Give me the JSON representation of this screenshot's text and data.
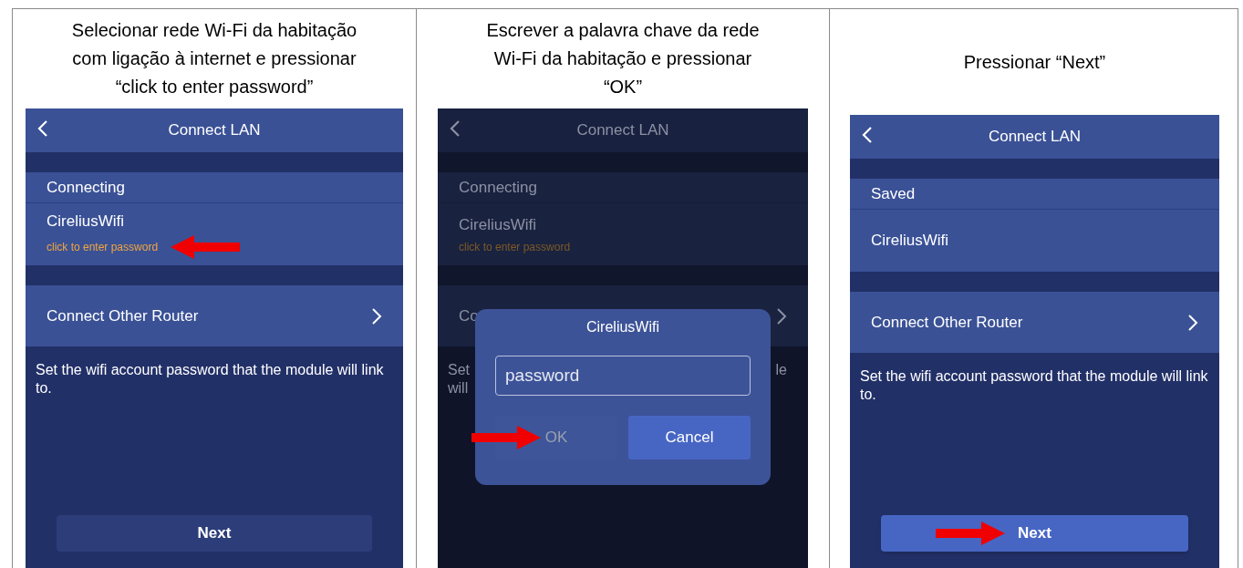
{
  "steps": [
    {
      "caption": "Selecionar rede Wi-Fi da habitação com ligação à internet e pressionar “click to enter password”",
      "screen": {
        "dimmed": false,
        "title": "Connect LAN",
        "section": "Connecting",
        "network": {
          "name": "CireliusWifi",
          "hint": "click to enter password",
          "pointed": true
        },
        "other_router": "Connect Other Router",
        "description": "Set the wifi account password that the module will link to.",
        "next_button": {
          "label": "Next",
          "highlighted": false,
          "pointed": false
        }
      }
    },
    {
      "caption": "Escrever a palavra chave da rede Wi-Fi da habitação e pressionar “OK”",
      "screen": {
        "dimmed": true,
        "title": "Connect LAN",
        "section": "Connecting",
        "network": {
          "name": "CireliusWifi",
          "hint": "click to enter password",
          "pointed": false
        },
        "other_router": "Co",
        "description_left": [
          "Set",
          "will"
        ],
        "description_right": [
          "le"
        ],
        "dialog": {
          "title": "CireliusWifi",
          "placeholder": "password",
          "buttons": [
            {
              "label": "OK",
              "primary": false,
              "pointed": true
            },
            {
              "label": "Cancel",
              "primary": true,
              "pointed": false
            }
          ]
        }
      }
    },
    {
      "caption": "Pressionar “Next”",
      "screen": {
        "dimmed": false,
        "title": "Connect LAN",
        "section": "Saved",
        "network": {
          "name": "CireliusWifi",
          "pointed": false
        },
        "other_router": "Connect Other Router",
        "description": "Set the wifi account password that the module will link to.",
        "next_button": {
          "label": "Next",
          "highlighted": true,
          "pointed": true
        }
      }
    }
  ]
}
